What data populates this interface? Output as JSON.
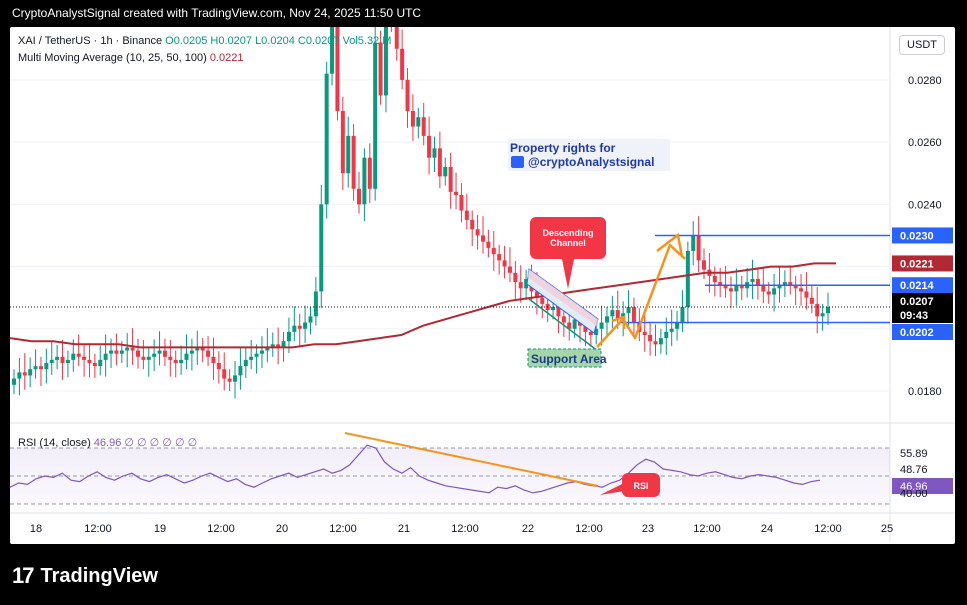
{
  "header": {
    "text": "CryptoAnalystSignal created with TradingView.com, Nov 24, 2025 11:50 UTC"
  },
  "legend": {
    "symbol": "XAI / TetherUS · 1h · Binance",
    "ohlc": "O0.0205  H0.0207  L0.0204  C0.0207  Vol5.32 M",
    "ma_label": "Multi Moving Average (10, 25, 50, 100)",
    "ma_value": "0.0221"
  },
  "currency_button": "USDT",
  "rsi_legend": {
    "label": "RSI (14, close)",
    "value": "46.96  ∅ ∅ ∅ ∅ ∅ ∅"
  },
  "footer": {
    "logo_text": "TradingView",
    "logo_mark": "17"
  },
  "colors": {
    "up": "#089981",
    "down": "#f23645",
    "ma": "#b22833",
    "level": "#2962ff",
    "arrow": "#f7931a",
    "rsi": "#7e57c2",
    "support": "#a5d6a7"
  },
  "annotations": {
    "property": "Property rights for",
    "handle": "@cryptoAnalystsignal",
    "descending": "Descending Channel",
    "support": "Support Area",
    "rsi": "RSI"
  },
  "chart_data": {
    "type": "candlestick",
    "x_ticks": [
      "18",
      "12:00",
      "19",
      "12:00",
      "20",
      "12:00",
      "21",
      "12:00",
      "22",
      "12:00",
      "23",
      "12:00",
      "24",
      "12:00",
      "25"
    ],
    "y_ticks": [
      "0.0180",
      "0.0200",
      "0.0220",
      "0.0240",
      "0.0260",
      "0.0280"
    ],
    "ylim": [
      0.0171,
      0.0297
    ],
    "price_labels": [
      {
        "text": "0.0230",
        "value": 0.023,
        "bg": "#2962ff"
      },
      {
        "text": "0.0221",
        "value": 0.0221,
        "bg": "#b22833"
      },
      {
        "text": "0.0214",
        "value": 0.0214,
        "bg": "#2962ff"
      },
      {
        "text": "0.0207",
        "value": 0.0207,
        "bg": "#000000"
      },
      {
        "text": "09:43",
        "value": 0.02035,
        "bg": "#000000"
      },
      {
        "text": "0.0202",
        "value": 0.0202,
        "bg": "#2962ff"
      }
    ],
    "levels": [
      0.023,
      0.0214,
      0.0202
    ],
    "current_price": 0.0207,
    "closes": [
      0.0184,
      0.0186,
      0.0185,
      0.0187,
      0.0188,
      0.0187,
      0.0189,
      0.019,
      0.0191,
      0.0189,
      0.019,
      0.0192,
      0.0191,
      0.019,
      0.0189,
      0.0188,
      0.019,
      0.0192,
      0.0193,
      0.0192,
      0.0193,
      0.0194,
      0.0193,
      0.0191,
      0.019,
      0.0191,
      0.0192,
      0.0193,
      0.0191,
      0.019,
      0.0189,
      0.019,
      0.0192,
      0.0193,
      0.0194,
      0.0193,
      0.0191,
      0.0189,
      0.0187,
      0.0184,
      0.0183,
      0.0185,
      0.0188,
      0.019,
      0.0191,
      0.0192,
      0.0193,
      0.0194,
      0.0195,
      0.0194,
      0.0196,
      0.0199,
      0.0201,
      0.02,
      0.0202,
      0.0204,
      0.0212,
      0.024,
      0.0282,
      0.031,
      0.027,
      0.025,
      0.0262,
      0.0245,
      0.024,
      0.0255,
      0.0245,
      0.0292,
      0.0275,
      0.03,
      0.0315,
      0.029,
      0.028,
      0.027,
      0.0265,
      0.0268,
      0.0262,
      0.0255,
      0.0258,
      0.0249,
      0.0252,
      0.0244,
      0.0243,
      0.0238,
      0.0235,
      0.0232,
      0.023,
      0.0228,
      0.0226,
      0.0224,
      0.0222,
      0.022,
      0.0218,
      0.0215,
      0.0213,
      0.0216,
      0.0212,
      0.021,
      0.0208,
      0.0206,
      0.0207,
      0.0204,
      0.0202,
      0.02,
      0.0203,
      0.0201,
      0.0199,
      0.0198,
      0.02,
      0.0202,
      0.0204,
      0.0206,
      0.0203,
      0.0205,
      0.0207,
      0.0202,
      0.0199,
      0.0198,
      0.0196,
      0.0195,
      0.0197,
      0.0199,
      0.02,
      0.0202,
      0.0207,
      0.0225,
      0.023,
      0.0222,
      0.0219,
      0.0217,
      0.0215,
      0.0214,
      0.0213,
      0.0212,
      0.0214,
      0.0213,
      0.0215,
      0.0216,
      0.0214,
      0.0212,
      0.0211,
      0.0213,
      0.0214,
      0.0215,
      0.0214,
      0.0213,
      0.0212,
      0.021,
      0.0208,
      0.0204,
      0.0205,
      0.0207
    ],
    "ma_values": [
      0.0197,
      0.0196,
      0.0196,
      0.0195,
      0.0195,
      0.0195,
      0.0194,
      0.0194,
      0.0194,
      0.0194,
      0.0194,
      0.0194,
      0.0194,
      0.0194,
      0.0195,
      0.0195,
      0.0196,
      0.0197,
      0.0198,
      0.0201,
      0.0203,
      0.0205,
      0.0207,
      0.0209,
      0.021,
      0.0211,
      0.0212,
      0.0213,
      0.0214,
      0.0215,
      0.0216,
      0.0217,
      0.0218,
      0.0218,
      0.0219,
      0.022,
      0.022,
      0.0221,
      0.0221
    ],
    "rsi": {
      "label": "RSI (14, close)",
      "value": 46.96,
      "levels_printed": [
        "55.89",
        "48.76",
        "46.96",
        "40.00"
      ],
      "ylim": [
        25,
        85
      ],
      "values": [
        42,
        45,
        44,
        48,
        50,
        49,
        52,
        47,
        46,
        50,
        53,
        49,
        47,
        50,
        52,
        48,
        46,
        49,
        51,
        48,
        45,
        47,
        50,
        52,
        49,
        46,
        48,
        44,
        42,
        45,
        48,
        50,
        52,
        49,
        51,
        53,
        55,
        52,
        54,
        58,
        65,
        72,
        70,
        60,
        55,
        52,
        56,
        50,
        47,
        45,
        43,
        42,
        41,
        40,
        39,
        38,
        42,
        41,
        43,
        40,
        38,
        39,
        41,
        43,
        45,
        46,
        44,
        43,
        42,
        45,
        47,
        52,
        58,
        62,
        60,
        55,
        54,
        53,
        51,
        50,
        52,
        53,
        51,
        49,
        48,
        50,
        51,
        50,
        49,
        47,
        45,
        44,
        46,
        47
      ]
    }
  }
}
